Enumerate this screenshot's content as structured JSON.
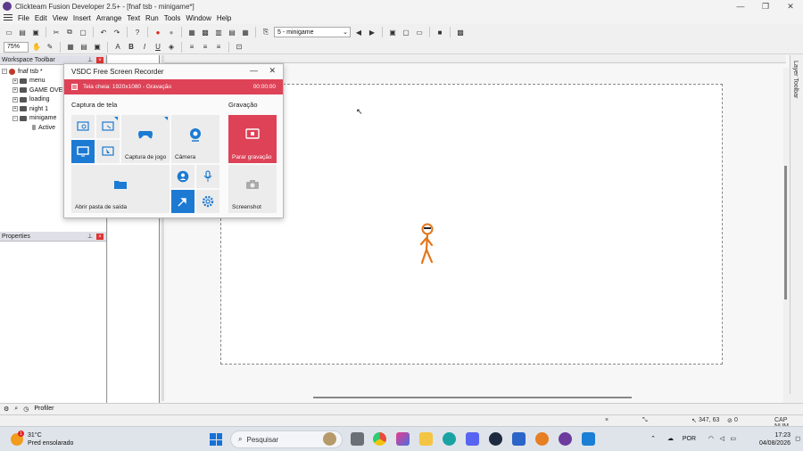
{
  "window": {
    "title": "Clickteam Fusion Developer 2.5+ - [fnaf tsb - minigame*]",
    "controls": [
      "—",
      "❐",
      "✕"
    ]
  },
  "menubar": {
    "items": [
      "File",
      "Edit",
      "View",
      "Insert",
      "Arrange",
      "Text",
      "Run",
      "Tools",
      "Window",
      "Help"
    ]
  },
  "toolbar": {
    "frame_select": "5 - minigame",
    "zoom": "75%"
  },
  "workspace": {
    "title": "Workspace Toolbar",
    "tree": [
      {
        "label": "fnaf tsb *",
        "expander": "−",
        "level": 0
      },
      {
        "label": "menu",
        "expander": "+",
        "level": 1
      },
      {
        "label": "GAME OVER",
        "expander": "+",
        "level": 1
      },
      {
        "label": "loading",
        "expander": "+",
        "level": 1
      },
      {
        "label": "night 1",
        "expander": "+",
        "level": 1
      },
      {
        "label": "minigame",
        "expander": "−",
        "level": 1
      },
      {
        "label": "Active",
        "expander": "",
        "level": 2
      }
    ]
  },
  "properties": {
    "title": "Properties"
  },
  "layer_toolbar": {
    "title": "Layer Toolbar"
  },
  "bottom": {
    "profiler": "Profiler"
  },
  "statusbar": {
    "coords": "347, 63",
    "count": "0",
    "caps": "CAP NUM"
  },
  "vsdc": {
    "title": "VSDC Free Screen Recorder",
    "rec_status": "Tela cheia: 1920x1080 - Gravação",
    "rec_time": "00:00:00",
    "capture_section": "Captura de tela",
    "recording_section": "Gravação",
    "game_capture": "Captura de jogo",
    "camera": "Câmera",
    "stop_recording": "Parar gravação",
    "open_folder": "Abrir pasta de saída",
    "screenshot": "Screenshot"
  },
  "taskbar": {
    "weather_temp": "31°C",
    "weather_desc": "Pred ensolarado",
    "weather_badge": "1",
    "search_placeholder": "Pesquisar",
    "language": "POR",
    "time": "17:23",
    "date": "04/08/2026"
  },
  "colors": {
    "vsdc_red": "#dd4257",
    "vsdc_blue": "#1c7ad3",
    "figure_orange": "#e2761a"
  }
}
